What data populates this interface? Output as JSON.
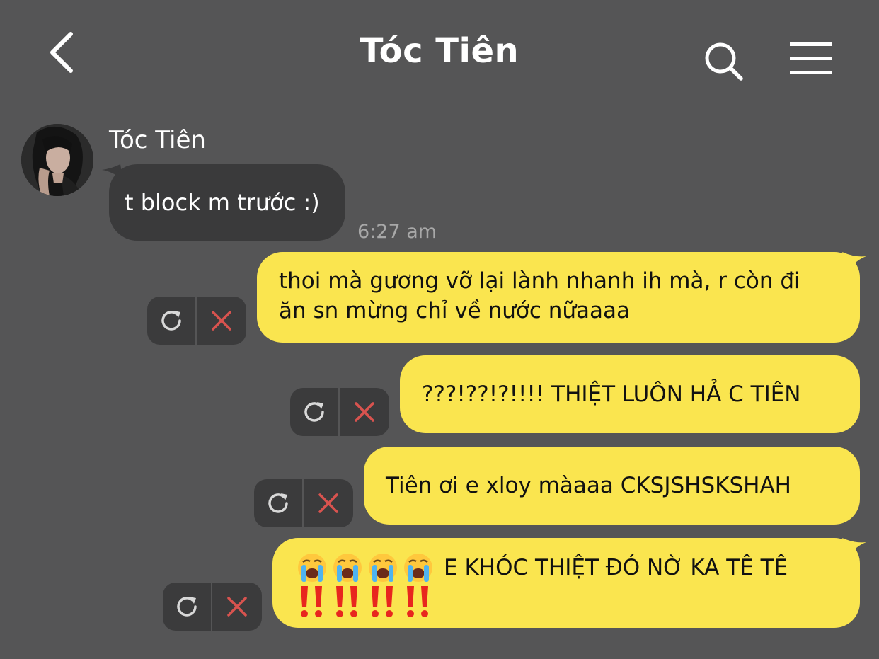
{
  "header": {
    "title": "Tóc Tiên"
  },
  "icons": {
    "back": "chevron-left-icon",
    "search": "search-icon",
    "menu": "hamburger-menu-icon",
    "retry": "refresh-icon",
    "delete": "close-icon"
  },
  "colors": {
    "background": "#555556",
    "incoming_bubble": "#3a3a3b",
    "outgoing_bubble": "#fae54f",
    "delete_x": "#d9534f",
    "timestamp": "#a8a8a8"
  },
  "incoming": {
    "sender": "Tóc Tiên",
    "text": "t block m trước :)",
    "time": "6:27 am"
  },
  "outgoing": [
    {
      "lines": [
        "thoi mà gương vỡ lại lành nhanh ih mà, r còn đi",
        "ăn sn mừng chỉ về nước nữaaaa"
      ]
    },
    {
      "text": "???!??!?!!!! THIỆT LUÔN HẢ C TIÊN"
    },
    {
      "text": "Tiên ơi e xloy màaaa CKSJSHSKSHAH"
    },
    {
      "emoji_line_text": "E KHÓC THIỆT ĐÓ NỜ KA TÊ TÊ",
      "emoji_before": "😭😭😭😭",
      "emoji_after": "‼️‼️‼️‼️"
    }
  ]
}
